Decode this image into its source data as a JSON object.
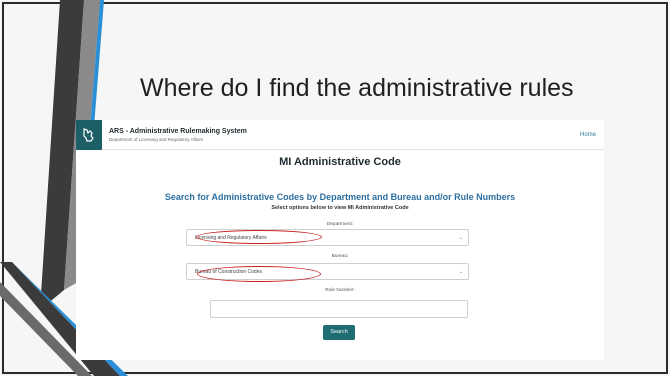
{
  "slide": {
    "title": "Where do I find the administrative rules"
  },
  "app": {
    "name": "ARS - Administrative Rulemaking System",
    "subtitle": "Department of Licensing and Regulatory Affairs",
    "nav_home": "Home"
  },
  "page": {
    "title": "MI Administrative Code",
    "search_heading": "Search for Administrative Codes by Department and Bureau and/or Rule Numbers",
    "search_subheading": "Select options below to view MI Administrative Code"
  },
  "form": {
    "department_label": "Department:",
    "department_value": "Licensing and Regulatory Affairs",
    "bureau_label": "Bureau:",
    "bureau_value": "Bureau of Construction Codes",
    "rule_number_label": "Rule Number:",
    "rule_number_value": "",
    "search_button": "Search"
  },
  "colors": {
    "logo_bg": "#1e5e67",
    "heading_blue": "#2e6fa0",
    "button": "#1e6d73",
    "highlight_circle": "#cc2222"
  },
  "icons": {
    "logo": "michigan-mitten-icon",
    "select_arrow": "chevron-down-icon"
  }
}
